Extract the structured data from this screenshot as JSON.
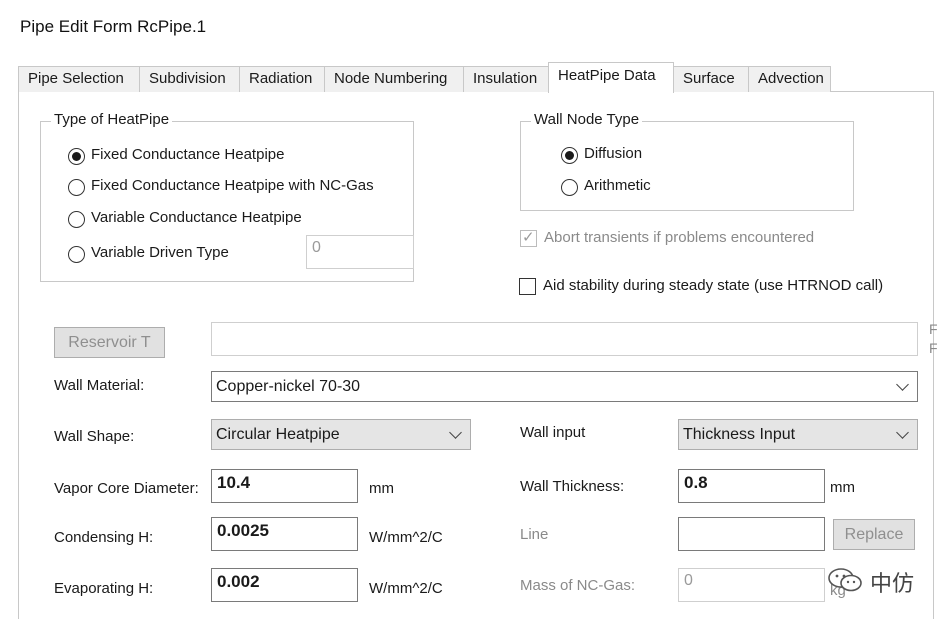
{
  "window": {
    "title": "Pipe Edit Form RcPipe.1"
  },
  "tabs": [
    {
      "label": "Pipe Selection"
    },
    {
      "label": "Subdivision"
    },
    {
      "label": "Radiation"
    },
    {
      "label": "Node Numbering"
    },
    {
      "label": "Insulation"
    },
    {
      "label": "HeatPipe Data"
    },
    {
      "label": "Surface"
    },
    {
      "label": "Advection"
    }
  ],
  "active_tab": "HeatPipe Data",
  "heatpipe_type": {
    "legend": "Type of HeatPipe",
    "options": [
      {
        "label": "Fixed Conductance Heatpipe",
        "selected": true
      },
      {
        "label": "Fixed Conductance Heatpipe with NC-Gas",
        "selected": false
      },
      {
        "label": "Variable Conductance Heatpipe",
        "selected": false
      },
      {
        "label": "Variable Driven Type",
        "selected": false
      }
    ],
    "variable_driven_value": "0"
  },
  "wall_node_type": {
    "legend": "Wall Node Type",
    "options": [
      {
        "label": "Diffusion",
        "selected": true
      },
      {
        "label": "Arithmetic",
        "selected": false
      }
    ]
  },
  "abort_transients": {
    "label": "Abort transients if problems encountered",
    "checked": true,
    "enabled": false
  },
  "aid_stability": {
    "label": "Aid stability during steady state (use HTRNOD call)",
    "checked": false,
    "enabled": true
  },
  "reservoir": {
    "button_label": "Reservoir T",
    "value": "",
    "edge_text_1": "F",
    "edge_text_2": "F"
  },
  "wall_material": {
    "label": "Wall Material:",
    "value": "Copper-nickel 70-30"
  },
  "wall_shape": {
    "label": "Wall Shape:",
    "value": "Circular Heatpipe"
  },
  "wall_input": {
    "label": "Wall input",
    "value": "Thickness Input"
  },
  "vapor_core_diameter": {
    "label": "Vapor Core Diameter:",
    "value": "10.4",
    "unit": "mm"
  },
  "wall_thickness": {
    "label": "Wall Thickness:",
    "value": "0.8",
    "unit": "mm"
  },
  "condensing_h": {
    "label": "Condensing H:",
    "value": "0.0025",
    "unit": "W/mm^2/C"
  },
  "line": {
    "label": "Line",
    "value": "",
    "button_label": "Replace"
  },
  "evaporating_h": {
    "label": "Evaporating H:",
    "value": "0.002",
    "unit": "W/mm^2/C"
  },
  "mass_nc_gas": {
    "label": "Mass of NC-Gas:",
    "value": "0",
    "unit": "kg"
  },
  "watermark": {
    "text": "中仿"
  },
  "colors": {
    "disabled_text": "#8a8a8a",
    "border": "#c8c8c8",
    "tab_inactive": "#f0f0f0",
    "button_face": "#e1e1e1"
  }
}
